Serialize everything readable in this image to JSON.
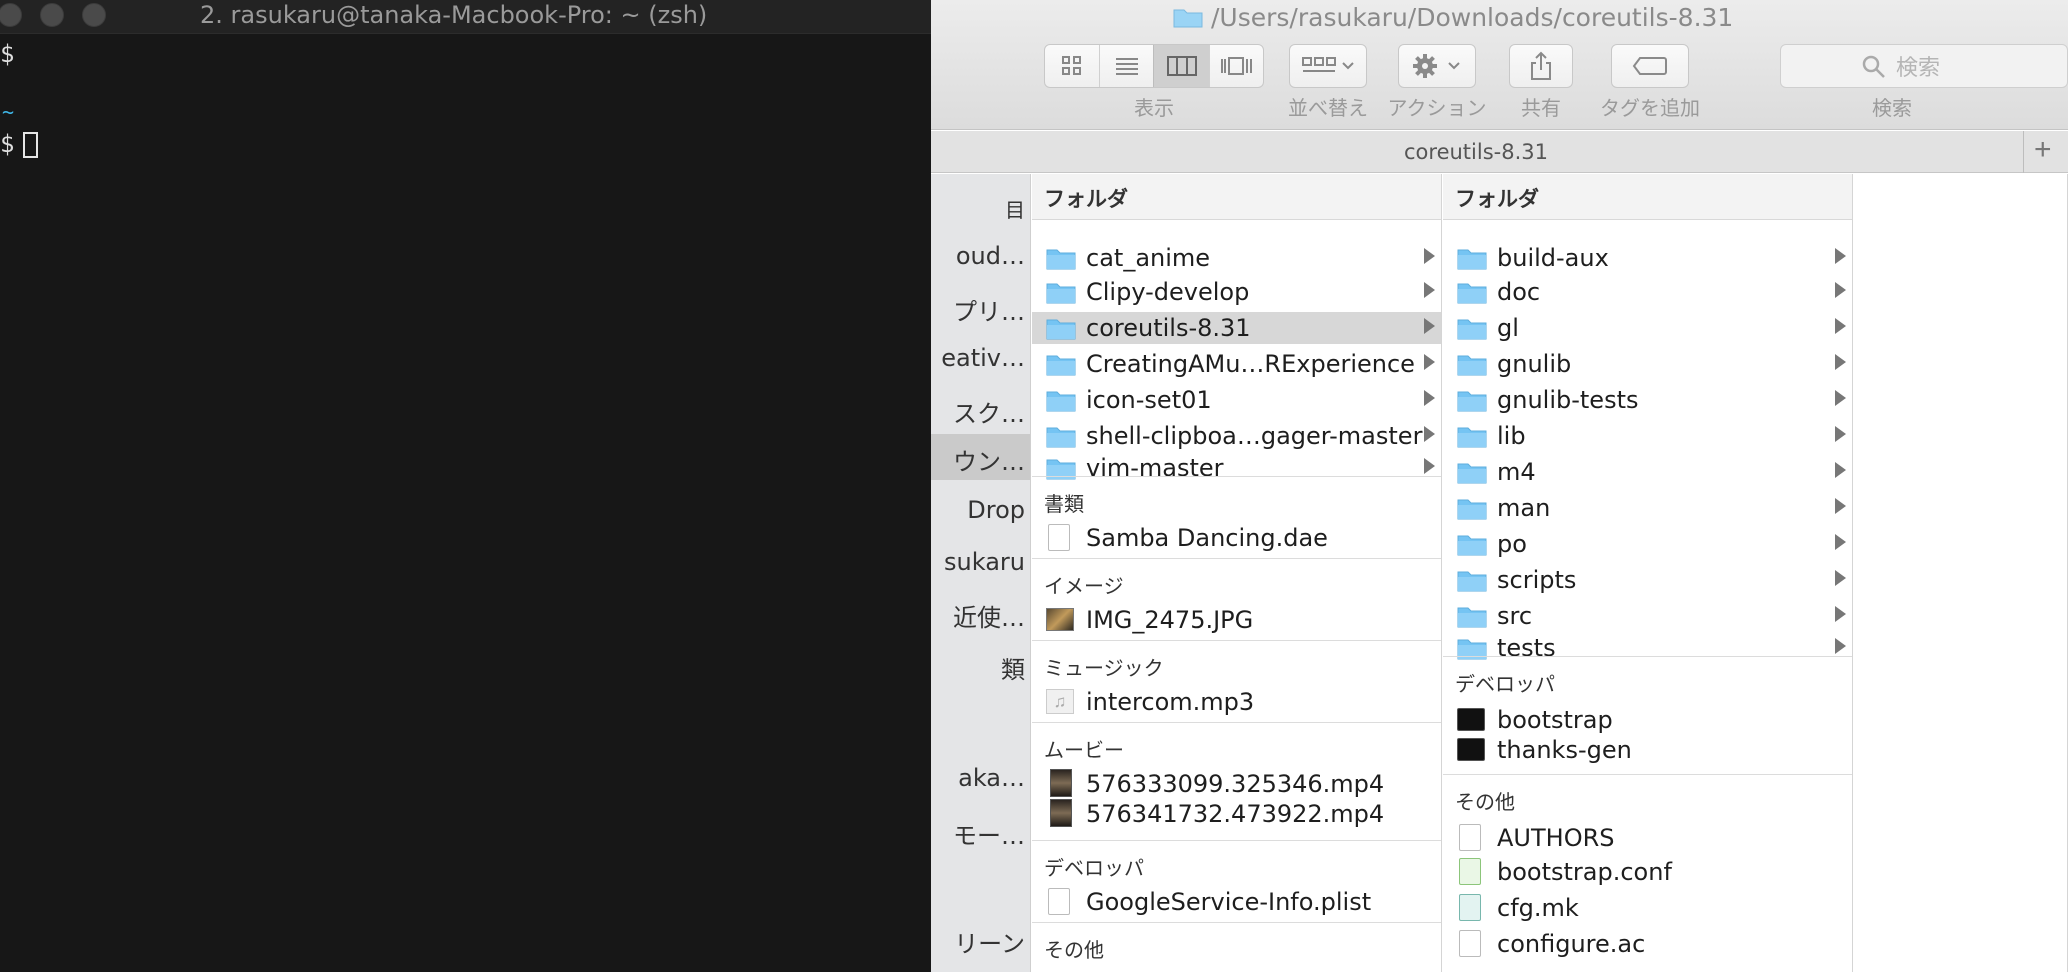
{
  "terminal": {
    "title": "2. rasukaru@tanaka-Macbook-Pro: ~ (zsh)",
    "lines": [
      "$",
      "~",
      "$"
    ]
  },
  "finder": {
    "title": "/Users/rasukaru/Downloads/coreutils-8.31",
    "path_title": "coreutils-8.31",
    "toolbar": {
      "view_label": "表示",
      "sort_label": "並べ替え",
      "action_label": "アクション",
      "share_label": "共有",
      "tag_label": "タグを追加",
      "search_label": "検索",
      "search_placeholder": "検索"
    },
    "sidebar": {
      "items": [
        "目",
        "oud…",
        "プリ…",
        "eativ…",
        "スク…",
        "ウン…",
        "Drop",
        "sukaru",
        "近使…",
        "類",
        "aka…",
        "モー…",
        "リーン"
      ]
    },
    "column1": {
      "header": "フォルダ",
      "folders": [
        "cat_anime",
        "Clipy-develop",
        "coreutils-8.31",
        "CreatingAMu…RExperience",
        "icon-set01",
        "shell-clipboa…gager-master",
        "vim-master"
      ],
      "selected_folder": "coreutils-8.31",
      "groups": [
        {
          "title": "書類",
          "items": [
            "Samba Dancing.dae"
          ]
        },
        {
          "title": "イメージ",
          "items": [
            "IMG_2475.JPG"
          ]
        },
        {
          "title": "ミュージック",
          "items": [
            "intercom.mp3"
          ]
        },
        {
          "title": "ムービー",
          "items": [
            "576333099.325346.mp4",
            "576341732.473922.mp4"
          ]
        },
        {
          "title": "デベロッパ",
          "items": [
            "GoogleService-Info.plist"
          ]
        },
        {
          "title": "その他",
          "items": []
        }
      ]
    },
    "column2": {
      "header": "フォルダ",
      "folders": [
        "build-aux",
        "doc",
        "gl",
        "gnulib",
        "gnulib-tests",
        "lib",
        "m4",
        "man",
        "po",
        "scripts",
        "src",
        "tests"
      ],
      "groups": [
        {
          "title": "デベロッパ",
          "items": [
            "bootstrap",
            "thanks-gen"
          ]
        },
        {
          "title": "その他",
          "items": [
            "AUTHORS",
            "bootstrap.conf",
            "cfg.mk",
            "configure.ac"
          ]
        }
      ]
    }
  },
  "colors": {
    "terminal_bg": "#171717",
    "folder_blue": "#6cc3f5",
    "selection_gray": "#d7d7d7"
  }
}
